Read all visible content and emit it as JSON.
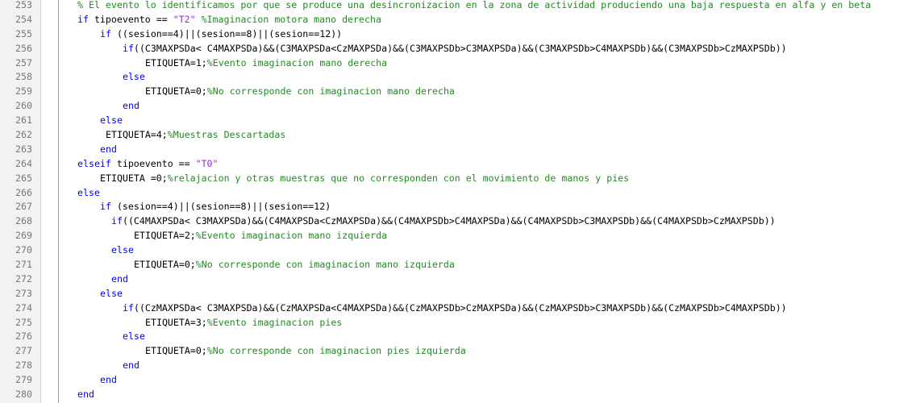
{
  "colors": {
    "keyword": "#0000ff",
    "string": "#a020f0",
    "comment": "#228b22",
    "text": "#000000",
    "line_number": "#787878",
    "gutter_bg": "#f2f2f2"
  },
  "lines": [
    {
      "n": "253",
      "indent": 0,
      "tokens": [
        {
          "t": "c",
          "v": "% El evento lo identificamos por que se produce una desincronizacion en la zona de actividad produciendo una baja respuesta en alfa y en beta"
        }
      ]
    },
    {
      "n": "254",
      "indent": 0,
      "tokens": [
        {
          "t": "k",
          "v": "if"
        },
        {
          "t": "p",
          "v": " tipoevento == "
        },
        {
          "t": "s",
          "v": "\"T2\""
        },
        {
          "t": "p",
          "v": " "
        },
        {
          "t": "c",
          "v": "%Imaginacion motora mano derecha"
        }
      ]
    },
    {
      "n": "255",
      "indent": 4,
      "tokens": [
        {
          "t": "k",
          "v": "if"
        },
        {
          "t": "p",
          "v": " ((sesion==4)||(sesion==8)||(sesion==12))"
        }
      ]
    },
    {
      "n": "256",
      "indent": 8,
      "tokens": [
        {
          "t": "k",
          "v": "if"
        },
        {
          "t": "p",
          "v": "((C3MAXPSDa< C4MAXPSDa)&&(C3MAXPSDa<CzMAXPSDa)&&(C3MAXPSDb>C3MAXPSDa)&&(C3MAXPSDb>C4MAXPSDb)&&(C3MAXPSDb>CzMAXPSDb))"
        }
      ]
    },
    {
      "n": "257",
      "indent": 12,
      "tokens": [
        {
          "t": "p",
          "v": "ETIQUETA=1;"
        },
        {
          "t": "c",
          "v": "%Evento imaginacion mano derecha"
        }
      ]
    },
    {
      "n": "258",
      "indent": 8,
      "tokens": [
        {
          "t": "k",
          "v": "else"
        }
      ]
    },
    {
      "n": "259",
      "indent": 12,
      "tokens": [
        {
          "t": "p",
          "v": "ETIQUETA=0;"
        },
        {
          "t": "c",
          "v": "%No corresponde con imaginacion mano derecha"
        }
      ]
    },
    {
      "n": "260",
      "indent": 8,
      "tokens": [
        {
          "t": "k",
          "v": "end"
        }
      ]
    },
    {
      "n": "261",
      "indent": 4,
      "tokens": [
        {
          "t": "k",
          "v": "else"
        }
      ]
    },
    {
      "n": "262",
      "indent": 5,
      "tokens": [
        {
          "t": "p",
          "v": "ETIQUETA=4;"
        },
        {
          "t": "c",
          "v": "%Muestras Descartadas"
        }
      ]
    },
    {
      "n": "263",
      "indent": 4,
      "tokens": [
        {
          "t": "k",
          "v": "end"
        }
      ]
    },
    {
      "n": "264",
      "indent": 0,
      "tokens": [
        {
          "t": "k",
          "v": "elseif"
        },
        {
          "t": "p",
          "v": " tipoevento == "
        },
        {
          "t": "s",
          "v": "\"T0\""
        }
      ]
    },
    {
      "n": "265",
      "indent": 4,
      "tokens": [
        {
          "t": "p",
          "v": "ETIQUETA =0;"
        },
        {
          "t": "c",
          "v": "%relajacion y otras muestras que no corresponden con el movimiento de manos y pies"
        }
      ]
    },
    {
      "n": "266",
      "indent": 0,
      "tokens": [
        {
          "t": "k",
          "v": "else"
        }
      ]
    },
    {
      "n": "267",
      "indent": 4,
      "tokens": [
        {
          "t": "k",
          "v": "if"
        },
        {
          "t": "p",
          "v": " (sesion==4)||(sesion==8)||(sesion==12)"
        }
      ]
    },
    {
      "n": "268",
      "indent": 6,
      "tokens": [
        {
          "t": "k",
          "v": "if"
        },
        {
          "t": "p",
          "v": "((C4MAXPSDa< C3MAXPSDa)&&(C4MAXPSDa<CzMAXPSDa)&&(C4MAXPSDb>C4MAXPSDa)&&(C4MAXPSDb>C3MAXPSDb)&&(C4MAXPSDb>CzMAXPSDb))"
        }
      ]
    },
    {
      "n": "269",
      "indent": 10,
      "tokens": [
        {
          "t": "p",
          "v": "ETIQUETA=2;"
        },
        {
          "t": "c",
          "v": "%Evento imaginacion mano izquierda"
        }
      ]
    },
    {
      "n": "270",
      "indent": 6,
      "tokens": [
        {
          "t": "k",
          "v": "else"
        }
      ]
    },
    {
      "n": "271",
      "indent": 10,
      "tokens": [
        {
          "t": "p",
          "v": "ETIQUETA=0;"
        },
        {
          "t": "c",
          "v": "%No corresponde con imaginacion mano izquierda"
        }
      ]
    },
    {
      "n": "272",
      "indent": 6,
      "tokens": [
        {
          "t": "k",
          "v": "end"
        }
      ]
    },
    {
      "n": "273",
      "indent": 4,
      "tokens": [
        {
          "t": "k",
          "v": "else"
        }
      ]
    },
    {
      "n": "274",
      "indent": 8,
      "tokens": [
        {
          "t": "k",
          "v": "if"
        },
        {
          "t": "p",
          "v": "((CzMAXPSDa< C3MAXPSDa)&&(CzMAXPSDa<C4MAXPSDa)&&(CzMAXPSDb>CzMAXPSDa)&&(CzMAXPSDb>C3MAXPSDb)&&(CzMAXPSDb>C4MAXPSDb))"
        }
      ]
    },
    {
      "n": "275",
      "indent": 12,
      "tokens": [
        {
          "t": "p",
          "v": "ETIQUETA=3;"
        },
        {
          "t": "c",
          "v": "%Evento imaginacion pies"
        }
      ]
    },
    {
      "n": "276",
      "indent": 8,
      "tokens": [
        {
          "t": "k",
          "v": "else"
        }
      ]
    },
    {
      "n": "277",
      "indent": 12,
      "tokens": [
        {
          "t": "p",
          "v": "ETIQUETA=0;"
        },
        {
          "t": "c",
          "v": "%No corresponde con imaginacion pies izquierda"
        }
      ]
    },
    {
      "n": "278",
      "indent": 8,
      "tokens": [
        {
          "t": "k",
          "v": "end"
        }
      ]
    },
    {
      "n": "279",
      "indent": 4,
      "tokens": [
        {
          "t": "k",
          "v": "end"
        }
      ]
    },
    {
      "n": "280",
      "indent": 0,
      "tokens": [
        {
          "t": "k",
          "v": "end"
        }
      ]
    }
  ]
}
